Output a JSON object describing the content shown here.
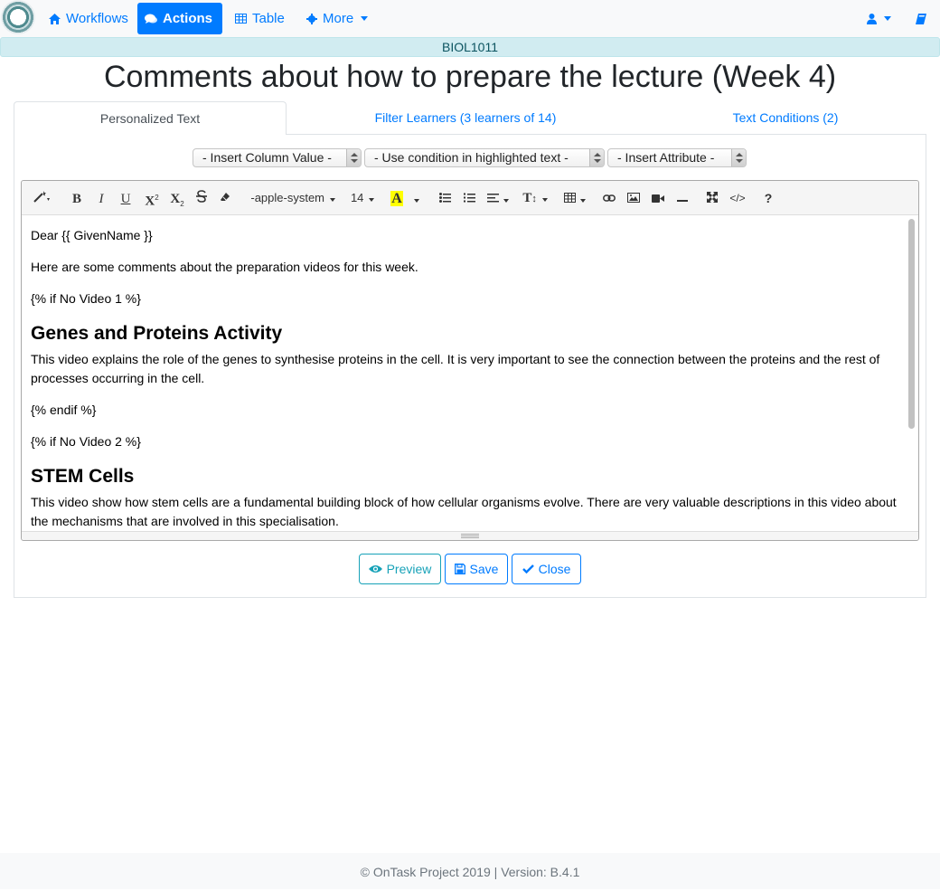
{
  "navbar": {
    "workflows_label": "Workflows",
    "actions_label": "Actions",
    "table_label": "Table",
    "more_label": "More"
  },
  "course": {
    "code": "BIOL1011"
  },
  "page": {
    "title": "Comments about how to prepare the lecture (Week 4)"
  },
  "tabs": [
    {
      "label": "Personalized Text"
    },
    {
      "label": "Filter Learners (3 learners of 14)"
    },
    {
      "label": "Text Conditions (2)"
    }
  ],
  "selects": {
    "insert_column": "- Insert Column Value -",
    "use_condition": "- Use condition in highlighted text -",
    "insert_attribute": "- Insert Attribute -"
  },
  "toolbar": {
    "font_name": "-apple-system",
    "font_size": "14",
    "bold": "B",
    "italic": "I",
    "underline": "U",
    "color_letter": "A",
    "help": "?",
    "code": "</>",
    "height": "T",
    "sup": "X",
    "sub": "X"
  },
  "editor": {
    "p1": "Dear {{ GivenName }}",
    "p2": "Here are some comments about the preparation videos for this week.",
    "p3": "{% if No Video 1 %}",
    "h1": "Genes and Proteins Activity",
    "p4": "This video explains the role of the genes to synthesise proteins in the cell. It is very important to see the connection between the proteins and the rest of processes occurring in the cell.",
    "p5": "{% endif %}",
    "p6": "{% if No Video 2 %}",
    "h2": "STEM Cells",
    "p7": "This video show how stem cells are a fundamental building block of how cellular organisms evolve. There are very valuable descriptions in this video about the mechanisms that are involved in this specialisation."
  },
  "buttons": {
    "preview": "Preview",
    "save": "Save",
    "close": "Close"
  },
  "footer": {
    "text": "© OnTask Project 2019 | Version: B.4.1"
  },
  "colors": {
    "primary": "#007bff",
    "info": "#17a2b8",
    "banner_bg": "#d1ecf1",
    "highlight_yellow": "#ffff00"
  },
  "icons": {
    "workflows": "home-icon",
    "actions": "comments-icon",
    "table": "table-icon",
    "more": "gear-icon",
    "user": "user-icon",
    "docs": "book-icon"
  }
}
